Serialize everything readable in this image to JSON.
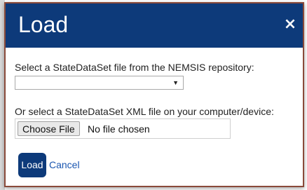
{
  "dialog": {
    "title": "Load",
    "close_label": "×",
    "repository_label": "Select a StateDataSet file from the NEMSIS repository:",
    "repository_select_value": "",
    "repository_select_arrow": "▼",
    "local_label": "Or select a StateDataSet XML file on your computer/device:",
    "file_button_label": "Choose File",
    "file_status": "No file chosen",
    "load_label": "Load",
    "cancel_label": "Cancel"
  },
  "colors": {
    "header": "#0d3a7a",
    "primary_button": "#0d3a7a",
    "link": "#1a56b0",
    "modal_border": "#8a4a3a"
  }
}
